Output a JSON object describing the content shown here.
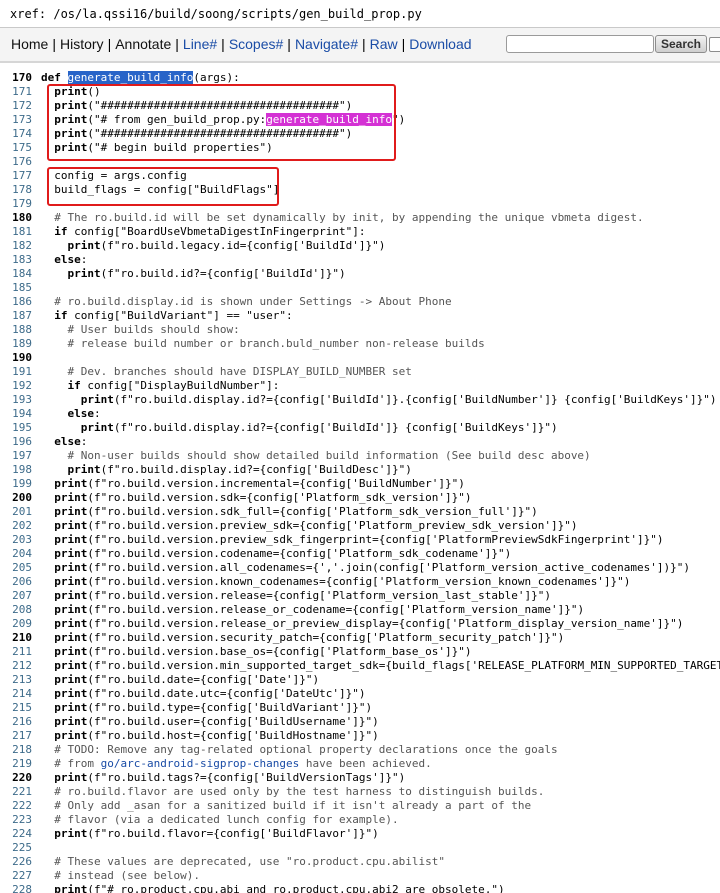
{
  "header": {
    "xref_path": "xref: /os/la.qssi16/build/soong/scripts/gen_build_prop.py"
  },
  "nav": {
    "items": [
      {
        "name": "nav-home",
        "label": "Home",
        "style": "dark"
      },
      {
        "name": "nav-history",
        "label": "History",
        "style": "dark"
      },
      {
        "name": "nav-annotate",
        "label": "Annotate",
        "style": "dark"
      },
      {
        "name": "nav-line",
        "label": "Line#",
        "style": "blue"
      },
      {
        "name": "nav-scopes",
        "label": "Scopes#",
        "style": "blue"
      },
      {
        "name": "nav-navigate",
        "label": "Navigate#",
        "style": "blue"
      },
      {
        "name": "nav-raw",
        "label": "Raw",
        "style": "blue"
      },
      {
        "name": "nav-download",
        "label": "Download",
        "style": "blue"
      }
    ],
    "search_button": "Search",
    "search_value": ""
  },
  "colors": {
    "function_highlight": "#2864c8",
    "search_match_highlight": "#d431d4",
    "annotation_box": "#e01b1b",
    "link": "#1a4ca6"
  },
  "code": {
    "lines": [
      {
        "n": "170",
        "b": true,
        "s": [
          {
            "t": "def ",
            "c": "kw"
          },
          {
            "t": "generate_build_info",
            "c": "fn-hl"
          },
          {
            "t": "(args):"
          }
        ]
      },
      {
        "n": "171",
        "s": [
          {
            "t": "  "
          },
          {
            "t": "print",
            "c": "kw"
          },
          {
            "t": "()"
          }
        ]
      },
      {
        "n": "172",
        "s": [
          {
            "t": "  "
          },
          {
            "t": "print",
            "c": "kw"
          },
          {
            "t": "(\"####################################\")"
          }
        ]
      },
      {
        "n": "173",
        "s": [
          {
            "t": "  "
          },
          {
            "t": "print",
            "c": "kw"
          },
          {
            "t": "(\"# from gen_build_prop.py:"
          },
          {
            "t": "generate_build_info",
            "c": "fn-pink"
          },
          {
            "t": "\")"
          }
        ]
      },
      {
        "n": "174",
        "s": [
          {
            "t": "  "
          },
          {
            "t": "print",
            "c": "kw"
          },
          {
            "t": "(\"####################################\")"
          }
        ]
      },
      {
        "n": "175",
        "s": [
          {
            "t": "  "
          },
          {
            "t": "print",
            "c": "kw"
          },
          {
            "t": "(\"# begin build properties\")"
          }
        ]
      },
      {
        "n": "176",
        "s": []
      },
      {
        "n": "177",
        "s": [
          {
            "t": "  config = args.config"
          }
        ]
      },
      {
        "n": "178",
        "s": [
          {
            "t": "  build_flags = config[\"BuildFlags\"]"
          }
        ]
      },
      {
        "n": "179",
        "s": []
      },
      {
        "n": "180",
        "b": true,
        "s": [
          {
            "t": "  "
          },
          {
            "t": "# The ro.build.id will be set dynamically by init, by appending the unique vbmeta digest.",
            "c": "cmt"
          }
        ]
      },
      {
        "n": "181",
        "s": [
          {
            "t": "  "
          },
          {
            "t": "if",
            "c": "kw"
          },
          {
            "t": " config[\"BoardUseVbmetaDigestInFingerprint\"]:"
          }
        ]
      },
      {
        "n": "182",
        "s": [
          {
            "t": "    "
          },
          {
            "t": "print",
            "c": "kw"
          },
          {
            "t": "(f\"ro.build.legacy.id={config['BuildId']}\")"
          }
        ]
      },
      {
        "n": "183",
        "s": [
          {
            "t": "  "
          },
          {
            "t": "else",
            "c": "kw"
          },
          {
            "t": ":"
          }
        ]
      },
      {
        "n": "184",
        "s": [
          {
            "t": "    "
          },
          {
            "t": "print",
            "c": "kw"
          },
          {
            "t": "(f\"ro.build.id?={config['BuildId']}\")"
          }
        ]
      },
      {
        "n": "185",
        "s": []
      },
      {
        "n": "186",
        "s": [
          {
            "t": "  "
          },
          {
            "t": "# ro.build.display.id is shown under Settings -> About Phone",
            "c": "cmt"
          }
        ]
      },
      {
        "n": "187",
        "s": [
          {
            "t": "  "
          },
          {
            "t": "if",
            "c": "kw"
          },
          {
            "t": " config[\"BuildVariant\"] == \"user\":"
          }
        ]
      },
      {
        "n": "188",
        "s": [
          {
            "t": "    "
          },
          {
            "t": "# User builds should show:",
            "c": "cmt"
          }
        ]
      },
      {
        "n": "189",
        "s": [
          {
            "t": "    "
          },
          {
            "t": "# release build number or branch.buld_number non-release builds",
            "c": "cmt"
          }
        ]
      },
      {
        "n": "190",
        "b": true,
        "s": []
      },
      {
        "n": "191",
        "s": [
          {
            "t": "    "
          },
          {
            "t": "# Dev. branches should have DISPLAY_BUILD_NUMBER set",
            "c": "cmt"
          }
        ]
      },
      {
        "n": "192",
        "s": [
          {
            "t": "    "
          },
          {
            "t": "if",
            "c": "kw"
          },
          {
            "t": " config[\"DisplayBuildNumber\"]:"
          }
        ]
      },
      {
        "n": "193",
        "s": [
          {
            "t": "      "
          },
          {
            "t": "print",
            "c": "kw"
          },
          {
            "t": "(f\"ro.build.display.id?={config['BuildId']}.{config['BuildNumber']} {config['BuildKeys']}\")"
          }
        ]
      },
      {
        "n": "194",
        "s": [
          {
            "t": "    "
          },
          {
            "t": "else",
            "c": "kw"
          },
          {
            "t": ":"
          }
        ]
      },
      {
        "n": "195",
        "s": [
          {
            "t": "      "
          },
          {
            "t": "print",
            "c": "kw"
          },
          {
            "t": "(f\"ro.build.display.id?={config['BuildId']} {config['BuildKeys']}\")"
          }
        ]
      },
      {
        "n": "196",
        "s": [
          {
            "t": "  "
          },
          {
            "t": "else",
            "c": "kw"
          },
          {
            "t": ":"
          }
        ]
      },
      {
        "n": "197",
        "s": [
          {
            "t": "    "
          },
          {
            "t": "# Non-user builds should show detailed build information (See build desc above)",
            "c": "cmt"
          }
        ]
      },
      {
        "n": "198",
        "s": [
          {
            "t": "    "
          },
          {
            "t": "print",
            "c": "kw"
          },
          {
            "t": "(f\"ro.build.display.id?={config['BuildDesc']}\")"
          }
        ]
      },
      {
        "n": "199",
        "s": [
          {
            "t": "  "
          },
          {
            "t": "print",
            "c": "kw"
          },
          {
            "t": "(f\"ro.build.version.incremental={config['BuildNumber']}\")"
          }
        ]
      },
      {
        "n": "200",
        "b": true,
        "s": [
          {
            "t": "  "
          },
          {
            "t": "print",
            "c": "kw"
          },
          {
            "t": "(f\"ro.build.version.sdk={config['Platform_sdk_version']}\")"
          }
        ]
      },
      {
        "n": "201",
        "s": [
          {
            "t": "  "
          },
          {
            "t": "print",
            "c": "kw"
          },
          {
            "t": "(f\"ro.build.version.sdk_full={config['Platform_sdk_version_full']}\")"
          }
        ]
      },
      {
        "n": "202",
        "s": [
          {
            "t": "  "
          },
          {
            "t": "print",
            "c": "kw"
          },
          {
            "t": "(f\"ro.build.version.preview_sdk={config['Platform_preview_sdk_version']}\")"
          }
        ]
      },
      {
        "n": "203",
        "s": [
          {
            "t": "  "
          },
          {
            "t": "print",
            "c": "kw"
          },
          {
            "t": "(f\"ro.build.version.preview_sdk_fingerprint={config['PlatformPreviewSdkFingerprint']}\")"
          }
        ]
      },
      {
        "n": "204",
        "s": [
          {
            "t": "  "
          },
          {
            "t": "print",
            "c": "kw"
          },
          {
            "t": "(f\"ro.build.version.codename={config['Platform_sdk_codename']}\")"
          }
        ]
      },
      {
        "n": "205",
        "s": [
          {
            "t": "  "
          },
          {
            "t": "print",
            "c": "kw"
          },
          {
            "t": "(f\"ro.build.version.all_codenames={','.join(config['Platform_version_active_codenames'])}\")"
          }
        ]
      },
      {
        "n": "206",
        "s": [
          {
            "t": "  "
          },
          {
            "t": "print",
            "c": "kw"
          },
          {
            "t": "(f\"ro.build.version.known_codenames={config['Platform_version_known_codenames']}\")"
          }
        ]
      },
      {
        "n": "207",
        "s": [
          {
            "t": "  "
          },
          {
            "t": "print",
            "c": "kw"
          },
          {
            "t": "(f\"ro.build.version.release={config['Platform_version_last_stable']}\")"
          }
        ]
      },
      {
        "n": "208",
        "s": [
          {
            "t": "  "
          },
          {
            "t": "print",
            "c": "kw"
          },
          {
            "t": "(f\"ro.build.version.release_or_codename={config['Platform_version_name']}\")"
          }
        ]
      },
      {
        "n": "209",
        "s": [
          {
            "t": "  "
          },
          {
            "t": "print",
            "c": "kw"
          },
          {
            "t": "(f\"ro.build.version.release_or_preview_display={config['Platform_display_version_name']}\")"
          }
        ]
      },
      {
        "n": "210",
        "b": true,
        "s": [
          {
            "t": "  "
          },
          {
            "t": "print",
            "c": "kw"
          },
          {
            "t": "(f\"ro.build.version.security_patch={config['Platform_security_patch']}\")"
          }
        ]
      },
      {
        "n": "211",
        "s": [
          {
            "t": "  "
          },
          {
            "t": "print",
            "c": "kw"
          },
          {
            "t": "(f\"ro.build.version.base_os={config['Platform_base_os']}\")"
          }
        ]
      },
      {
        "n": "212",
        "s": [
          {
            "t": "  "
          },
          {
            "t": "print",
            "c": "kw"
          },
          {
            "t": "(f\"ro.build.version.min_supported_target_sdk={build_flags['RELEASE_PLATFORM_MIN_SUPPORTED_TARGET_SDK_VERSION']}\")"
          }
        ]
      },
      {
        "n": "213",
        "s": [
          {
            "t": "  "
          },
          {
            "t": "print",
            "c": "kw"
          },
          {
            "t": "(f\"ro.build.date={config['Date']}\")"
          }
        ]
      },
      {
        "n": "214",
        "s": [
          {
            "t": "  "
          },
          {
            "t": "print",
            "c": "kw"
          },
          {
            "t": "(f\"ro.build.date.utc={config['DateUtc']}\")"
          }
        ]
      },
      {
        "n": "215",
        "s": [
          {
            "t": "  "
          },
          {
            "t": "print",
            "c": "kw"
          },
          {
            "t": "(f\"ro.build.type={config['BuildVariant']}\")"
          }
        ]
      },
      {
        "n": "216",
        "s": [
          {
            "t": "  "
          },
          {
            "t": "print",
            "c": "kw"
          },
          {
            "t": "(f\"ro.build.user={config['BuildUsername']}\")"
          }
        ]
      },
      {
        "n": "217",
        "s": [
          {
            "t": "  "
          },
          {
            "t": "print",
            "c": "kw"
          },
          {
            "t": "(f\"ro.build.host={config['BuildHostname']}\")"
          }
        ]
      },
      {
        "n": "218",
        "s": [
          {
            "t": "  "
          },
          {
            "t": "# TODO: Remove any tag-related optional property declarations once the goals",
            "c": "cmt"
          }
        ]
      },
      {
        "n": "219",
        "s": [
          {
            "t": "  "
          },
          {
            "t": "# from ",
            "c": "cmt"
          },
          {
            "t": "go/arc-android-sigprop-changes",
            "c": "link"
          },
          {
            "t": " have been achieved.",
            "c": "cmt"
          }
        ]
      },
      {
        "n": "220",
        "b": true,
        "s": [
          {
            "t": "  "
          },
          {
            "t": "print",
            "c": "kw"
          },
          {
            "t": "(f\"ro.build.tags?={config['BuildVersionTags']}\")"
          }
        ]
      },
      {
        "n": "221",
        "s": [
          {
            "t": "  "
          },
          {
            "t": "# ro.build.flavor are used only by the test harness to distinguish builds.",
            "c": "cmt"
          }
        ]
      },
      {
        "n": "222",
        "s": [
          {
            "t": "  "
          },
          {
            "t": "# Only add _asan for a sanitized build if it isn't already a part of the",
            "c": "cmt"
          }
        ]
      },
      {
        "n": "223",
        "s": [
          {
            "t": "  "
          },
          {
            "t": "# flavor (via a dedicated lunch config for example).",
            "c": "cmt"
          }
        ]
      },
      {
        "n": "224",
        "s": [
          {
            "t": "  "
          },
          {
            "t": "print",
            "c": "kw"
          },
          {
            "t": "(f\"ro.build.flavor={config['BuildFlavor']}\")"
          }
        ]
      },
      {
        "n": "225",
        "s": []
      },
      {
        "n": "226",
        "s": [
          {
            "t": "  "
          },
          {
            "t": "# These values are deprecated, use \"ro.product.cpu.abilist\"",
            "c": "cmt"
          }
        ]
      },
      {
        "n": "227",
        "s": [
          {
            "t": "  "
          },
          {
            "t": "# instead (see below).",
            "c": "cmt"
          }
        ]
      },
      {
        "n": "228",
        "s": [
          {
            "t": "  "
          },
          {
            "t": "print",
            "c": "kw"
          },
          {
            "t": "(f\"# ro.product.cpu.abi and ro.product.cpu.abi2 are obsolete,\")"
          }
        ]
      }
    ]
  }
}
